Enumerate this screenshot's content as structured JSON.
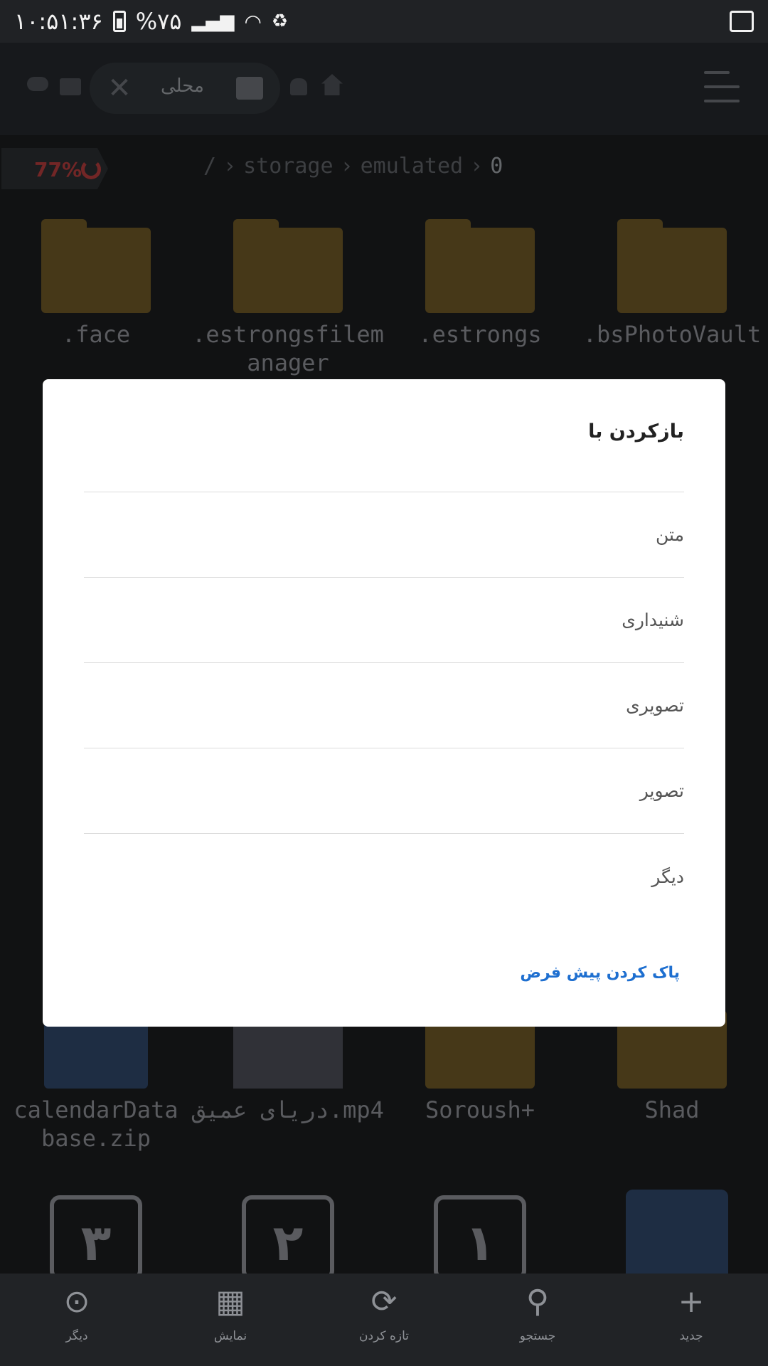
{
  "status_bar": {
    "time": "۱۰:۵۱:۳۶",
    "battery": "%۷۵"
  },
  "toolbar": {
    "location_chip_label": "محلی"
  },
  "path_bar": {
    "storage_usage": "77%",
    "breadcrumb": [
      "/",
      "storage",
      "emulated",
      "0"
    ]
  },
  "files": [
    {
      "name": ".bsPhotoVault",
      "type": "folder"
    },
    {
      "name": ".estrongs",
      "type": "folder"
    },
    {
      "name": ".estrongsfilemanager",
      "type": "folder"
    },
    {
      "name": ".face",
      "type": "folder"
    },
    {
      "name": "Shad",
      "type": "folder"
    },
    {
      "name": "Soroush+",
      "type": "folder"
    },
    {
      "name": "دریای عمیق.mp4",
      "type": "video"
    },
    {
      "name": "calendarDatabase.zip",
      "type": "zip"
    }
  ],
  "calendar_tiles": [
    "۳",
    "۲",
    "۱"
  ],
  "dialog": {
    "title": "بازکردن با",
    "options": [
      "متن",
      "شنیداری",
      "تصویری",
      "تصویر",
      "دیگر"
    ],
    "clear_default": "پاک کردن پیش فرض"
  },
  "bottom_nav": [
    {
      "label": "جدید",
      "icon": "plus-icon"
    },
    {
      "label": "جستجو",
      "icon": "search-icon"
    },
    {
      "label": "تازه کردن",
      "icon": "refresh-icon"
    },
    {
      "label": "نمایش",
      "icon": "grid-view-icon"
    },
    {
      "label": "دیگر",
      "icon": "more-icon"
    }
  ]
}
